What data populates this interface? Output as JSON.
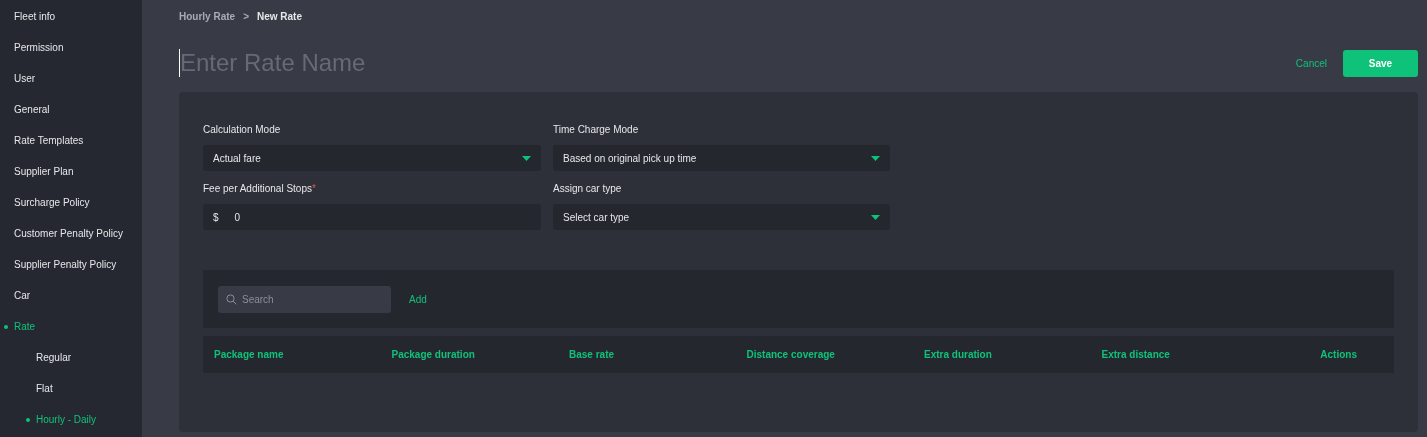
{
  "sidebar": {
    "items": [
      {
        "label": "Fleet info",
        "selected": false
      },
      {
        "label": "Permission",
        "selected": false
      },
      {
        "label": "User",
        "selected": false
      },
      {
        "label": "General",
        "selected": false
      },
      {
        "label": "Rate Templates",
        "selected": false
      },
      {
        "label": "Supplier Plan",
        "selected": false
      },
      {
        "label": "Surcharge Policy",
        "selected": false
      },
      {
        "label": "Customer Penalty Policy",
        "selected": false
      },
      {
        "label": "Supplier Penalty Policy",
        "selected": false
      },
      {
        "label": "Car",
        "selected": false
      },
      {
        "label": "Rate",
        "selected": true,
        "children": [
          {
            "label": "Regular",
            "selected": false
          },
          {
            "label": "Flat",
            "selected": false
          },
          {
            "label": "Hourly - Daily",
            "selected": true
          }
        ]
      }
    ]
  },
  "breadcrumb": [
    "Hourly Rate",
    "New Rate"
  ],
  "breadcrumb_separator": ">",
  "rate_name": {
    "placeholder": "Enter Rate Name"
  },
  "actions": {
    "cancel": "Cancel",
    "save": "Save"
  },
  "form": {
    "fields": [
      {
        "kind": "select",
        "label": "Calculation Mode",
        "value": "Actual fare"
      },
      {
        "kind": "select",
        "label": "Time Charge Mode",
        "value": "Based on original pick up time"
      },
      {
        "kind": "money",
        "label": "Fee per Additional Stops",
        "required": true,
        "required_mark": "*",
        "prefix": "$",
        "value": "0"
      },
      {
        "kind": "select",
        "label": "Assign car type",
        "placeholder": "Select car type"
      }
    ]
  },
  "packages": {
    "search": {
      "placeholder": "Search"
    },
    "add": "Add",
    "columns": [
      "Package name",
      "Package duration",
      "Base rate",
      "Distance coverage",
      "Extra duration",
      "Extra distance",
      "Actions"
    ]
  }
}
